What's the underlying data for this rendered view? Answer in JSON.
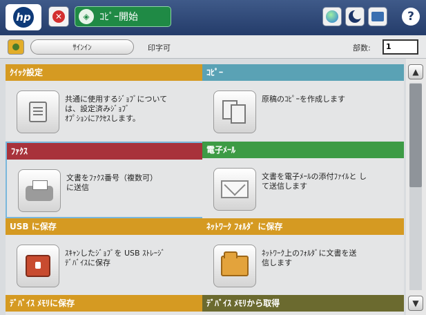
{
  "topbar": {
    "logo_text": "hp",
    "stop_icon": "stop-x-icon",
    "start_label": "ｺﾋﾟｰ開始",
    "help_label": "?"
  },
  "subbar": {
    "signin_label": "ｻｲﾝｲﾝ",
    "status_text": "印字可",
    "copies_label": "部数:",
    "copies_value": "1"
  },
  "tiles": [
    {
      "title": "ｸｲｯｸ設定",
      "description": "共通に使用するｼﾞｮﾌﾞについて\nは、設定済みｼﾞｮﾌﾞ\nｵﾌﾟｼｮﾝにｱｸｾｽします。",
      "color": "#d59a22",
      "icon": "quick-sets-icon"
    },
    {
      "title": "ｺﾋﾟｰ",
      "description": "原稿のｺﾋﾟｰを作成します",
      "color": "#5aa2b5",
      "icon": "copy-icon"
    },
    {
      "title": "ﾌｧｸｽ",
      "description": "文書をﾌｧｸｽ番号（複数可）\nに送信",
      "color": "#a8323b",
      "icon": "fax-icon"
    },
    {
      "title": "電子ﾒｰﾙ",
      "description": "文書を電子ﾒｰﾙの添付ﾌｧｲﾙと し\nて送信します",
      "color": "#3d9b45",
      "icon": "email-icon"
    },
    {
      "title": "USB に保存",
      "description": "ｽｷｬﾝしたｼﾞｮﾌﾞを USB ｽﾄﾚｰｼﾞ\nﾃﾞﾊﾞｲｽに保存",
      "color": "#d59a22",
      "icon": "usb-icon"
    },
    {
      "title": "ﾈｯﾄﾜｰｸ ﾌｫﾙﾀﾞ に保存",
      "description": "ﾈｯﾄﾜｰｸ上のﾌｫﾙﾀﾞに文書を送\n信します",
      "color": "#d59a22",
      "icon": "folder-icon"
    },
    {
      "title": "ﾃﾞﾊﾞｲｽ ﾒﾓﾘに保存",
      "description": "",
      "color": "#d59a22",
      "icon": ""
    },
    {
      "title": "ﾃﾞﾊﾞｲｽ ﾒﾓﾘから取得",
      "description": "",
      "color": "#6b6a2f",
      "icon": ""
    }
  ],
  "scroll": {
    "up_label": "▲",
    "down_label": "▼"
  }
}
